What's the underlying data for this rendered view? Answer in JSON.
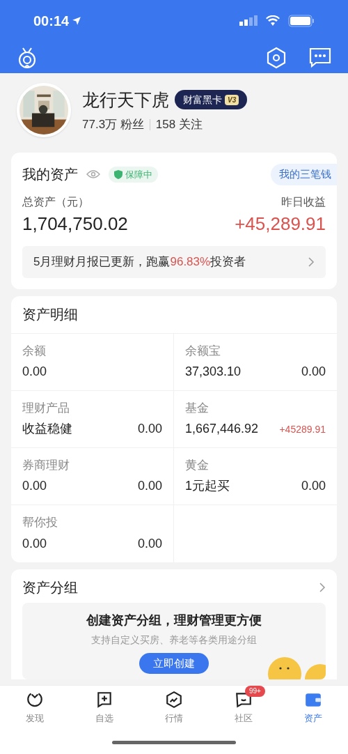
{
  "status_bar": {
    "time": "00:14"
  },
  "profile": {
    "name": "龙行天下虎",
    "badge": "财富黑卡",
    "level": "V3",
    "followers": "77.3万",
    "followers_label": "粉丝",
    "following": "158",
    "following_label": "关注"
  },
  "assets": {
    "title": "我的资产",
    "protection": "保障中",
    "link": "我的三笔钱",
    "total_label": "总资产（元）",
    "total": "1,704,750.02",
    "yesterday_label": "昨日收益",
    "yesterday": "+45,289.91",
    "report_prefix": "5月理财月报已更新，跑赢",
    "report_highlight": "96.83%",
    "report_suffix": "投资者"
  },
  "details": {
    "title": "资产明细",
    "items": [
      {
        "label": "余额",
        "value": "0.00"
      },
      {
        "label": "余额宝",
        "value": "37,303.10",
        "change": "0.00",
        "gain": false
      },
      {
        "label": "理财产品",
        "value": "收益稳健",
        "change": "0.00",
        "gain": false
      },
      {
        "label": "基金",
        "value": "1,667,446.92",
        "change": "+45289.91",
        "gain": true
      },
      {
        "label": "券商理财",
        "value": "0.00",
        "change": "0.00",
        "gain": false
      },
      {
        "label": "黄金",
        "value": "1元起买",
        "change": "0.00",
        "gain": false
      },
      {
        "label": "帮你投",
        "value": "0.00",
        "change": "0.00",
        "gain": false
      }
    ]
  },
  "groups": {
    "title": "资产分组",
    "promo_title": "创建资产分组，理财管理更方便",
    "promo_subtitle": "支持自定义买房、养老等各类用途分组",
    "button": "立即创建"
  },
  "tabs": [
    {
      "label": "发现",
      "selected": false
    },
    {
      "label": "自选",
      "selected": false
    },
    {
      "label": "行情",
      "selected": false
    },
    {
      "label": "社区",
      "selected": false,
      "badge": "99+"
    },
    {
      "label": "资产",
      "selected": true
    }
  ]
}
